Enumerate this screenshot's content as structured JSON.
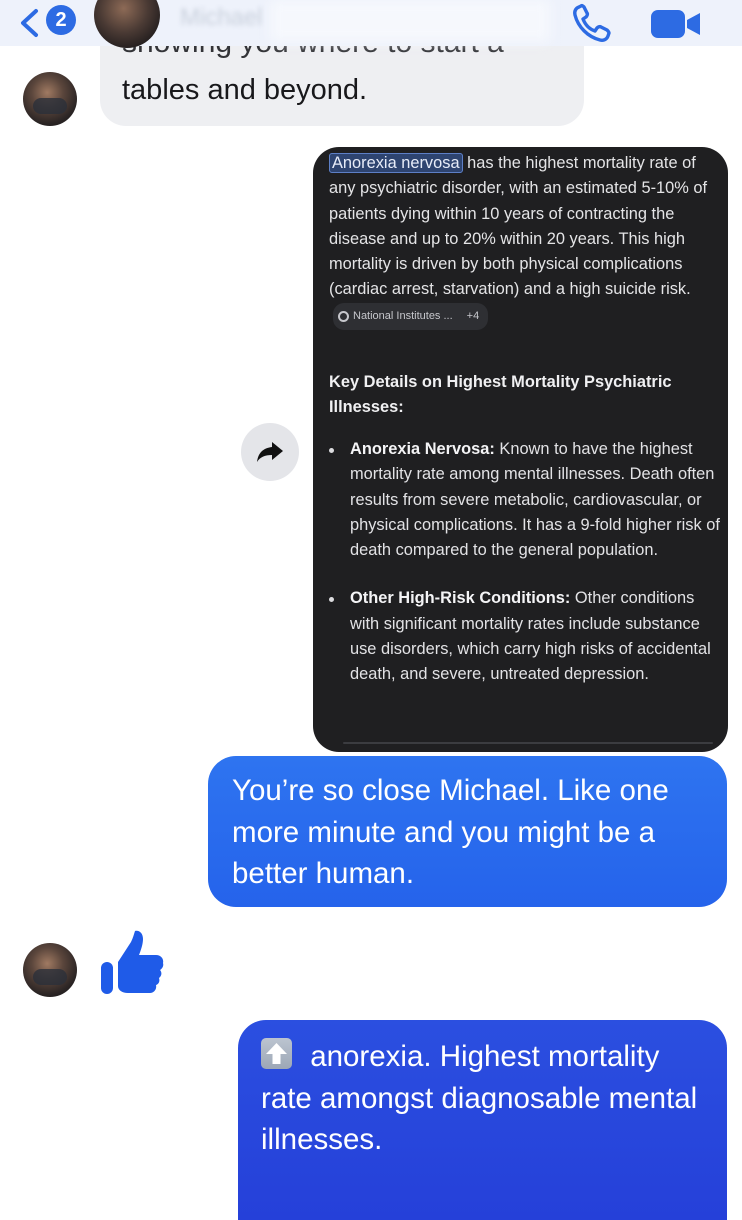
{
  "header": {
    "back_count": "2",
    "contact_name": "Michael",
    "icons": {
      "back": "chevron-left-icon",
      "call": "phone-icon",
      "video": "video-camera-icon"
    }
  },
  "messages": {
    "incoming_1": {
      "cut_text": "showing you where to start a",
      "text": "tables and beyond."
    },
    "forwarded_screenshot": {
      "highlight_term": "Anorexia nervosa",
      "paragraph_rest": " has the highest mortality rate of any psychiatric disorder, with an estimated 5-10% of patients dying within 10 years of contracting the disease and up to 20% within 20 years. This high mortality is driven by both physical complications (cardiac arrest, starvation) and a high suicide risk.",
      "source_label": "National Institutes ...",
      "source_more": "+4",
      "heading": "Key Details on Highest Mortality Psychiatric Illnesses:",
      "bullets": [
        {
          "title": "Anorexia Nervosa:",
          "text": " Known to have the highest mortality rate among mental illnesses. Death often results from severe metabolic, cardiovascular, or physical complications. It has a 9-fold higher risk of death compared to the general population."
        },
        {
          "title": "Other High-Risk Conditions:",
          "text": " Other conditions with significant mortality rates include substance use disorders, which carry high risks of accidental death, and severe, untreated depression."
        }
      ]
    },
    "outgoing_1": "You’re so close Michael. Like one more minute and you might be a better human.",
    "incoming_reaction": "thumbs-up-icon",
    "outgoing_2": " anorexia. Highest mortality rate amongst diagnosable mental illnesses."
  },
  "colors": {
    "outgoing_bubble": "#2563eb",
    "incoming_bubble": "#eeeff2",
    "accent": "#2d6be3",
    "screenshot_bg": "#1f1f21"
  }
}
